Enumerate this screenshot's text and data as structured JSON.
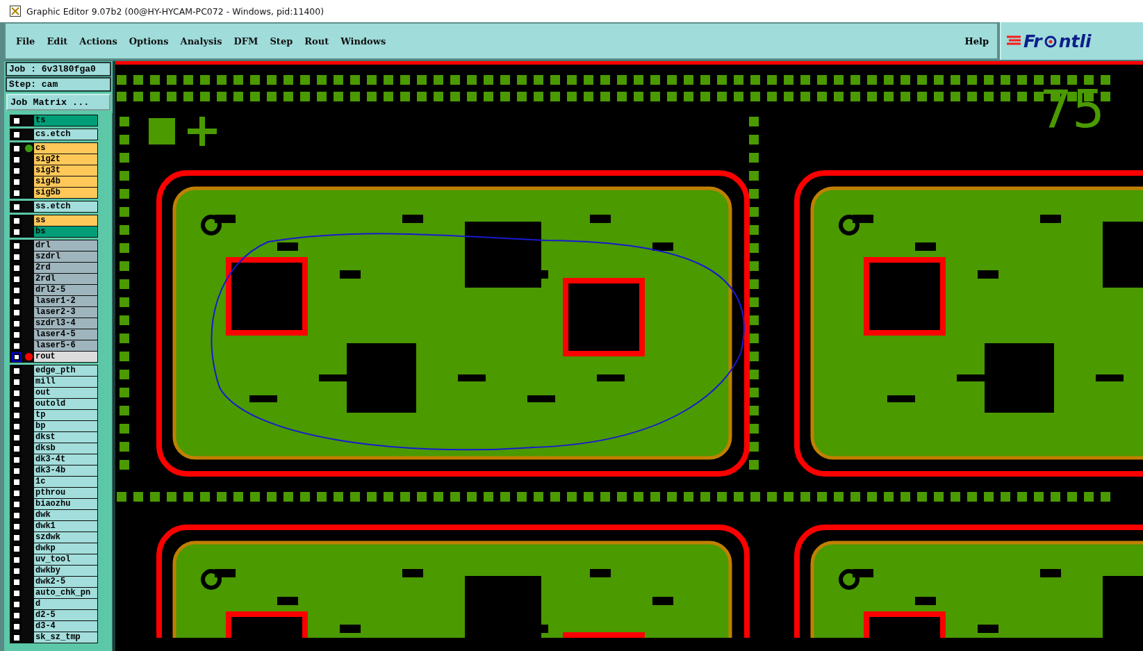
{
  "window": {
    "title": "Graphic Editor 9.07b2 (00@HY-HYCAM-PC072 - Windows, pid:11400)"
  },
  "menu": [
    "File",
    "Edit",
    "Actions",
    "Options",
    "Analysis",
    "DFM",
    "Step",
    "Rout",
    "Windows"
  ],
  "help": "Help",
  "logo": {
    "before": "Fr",
    "after": "ntli"
  },
  "job": "Job : 6v3l80fga0",
  "step": "Step: cam",
  "job_matrix_button": "Job Matrix ...",
  "layer_groups": [
    {
      "layers": [
        {
          "name": "ts",
          "color": "#009e78",
          "selected": false
        }
      ]
    },
    {
      "layers": [
        {
          "name": "cs.etch",
          "color": "#a3dedc",
          "selected": false
        }
      ]
    },
    {
      "layers": [
        {
          "name": "cs",
          "color": "#ffc859",
          "dot": {
            "color": "#3a9a10"
          },
          "selected": false
        },
        {
          "name": "sig2t",
          "color": "#ffc859",
          "selected": false
        },
        {
          "name": "sig3t",
          "color": "#ffc859",
          "selected": false
        },
        {
          "name": "sig4b",
          "color": "#ffc859",
          "selected": false
        },
        {
          "name": "sig5b",
          "color": "#ffc859",
          "selected": false
        }
      ]
    },
    {
      "layers": [
        {
          "name": "ss.etch",
          "color": "#a3dedc",
          "selected": false
        }
      ]
    },
    {
      "layers": [
        {
          "name": "ss",
          "color": "#ffc859",
          "selected": false
        },
        {
          "name": "bs",
          "color": "#009e78",
          "selected": false
        }
      ]
    },
    {
      "layers": [
        {
          "name": "drl",
          "color": "#9fb5bd",
          "selected": false
        },
        {
          "name": "szdrl",
          "color": "#9fb5bd",
          "selected": false
        },
        {
          "name": "2rd",
          "color": "#9fb5bd",
          "selected": false
        },
        {
          "name": "2rdl",
          "color": "#9fb5bd",
          "selected": false
        },
        {
          "name": "drl2-5",
          "color": "#9fb5bd",
          "selected": false
        },
        {
          "name": "laser1-2",
          "color": "#9fb5bd",
          "selected": false
        },
        {
          "name": "laser2-3",
          "color": "#9fb5bd",
          "selected": false
        },
        {
          "name": "szdrl3-4",
          "color": "#9fb5bd",
          "selected": false
        },
        {
          "name": "laser4-5",
          "color": "#9fb5bd",
          "selected": false
        },
        {
          "name": "laser5-6",
          "color": "#9fb5bd",
          "selected": false
        },
        {
          "name": "rout",
          "color": "#dcdcdc",
          "dot": {
            "color": "#ff0000"
          },
          "selected": true
        }
      ]
    },
    {
      "layers": [
        {
          "name": "edge_pth",
          "color": "#a3dedc",
          "selected": false
        },
        {
          "name": "mill",
          "color": "#a3dedc",
          "selected": false
        },
        {
          "name": "out",
          "color": "#a3dedc",
          "selected": false
        },
        {
          "name": "outold",
          "color": "#a3dedc",
          "selected": false
        },
        {
          "name": "tp",
          "color": "#a3dedc",
          "selected": false
        },
        {
          "name": "bp",
          "color": "#a3dedc",
          "selected": false
        },
        {
          "name": "dkst",
          "color": "#a3dedc",
          "selected": false
        },
        {
          "name": "dksb",
          "color": "#a3dedc",
          "selected": false
        },
        {
          "name": "dk3-4t",
          "color": "#a3dedc",
          "selected": false
        },
        {
          "name": "dk3-4b",
          "color": "#a3dedc",
          "selected": false
        },
        {
          "name": "1c",
          "color": "#a3dedc",
          "selected": false
        },
        {
          "name": "pthrou",
          "color": "#a3dedc",
          "selected": false
        },
        {
          "name": "biaozhu",
          "color": "#a3dedc",
          "selected": false
        },
        {
          "name": "dwk",
          "color": "#a3dedc",
          "selected": false
        },
        {
          "name": "dwk1",
          "color": "#a3dedc",
          "selected": false
        },
        {
          "name": "szdwk",
          "color": "#a3dedc",
          "selected": false
        },
        {
          "name": "dwkp",
          "color": "#a3dedc",
          "selected": false
        },
        {
          "name": "uv_tool",
          "color": "#a3dedc",
          "selected": false
        },
        {
          "name": "dwkby",
          "color": "#a3dedc",
          "selected": false
        },
        {
          "name": "dwk2-5",
          "color": "#a3dedc",
          "selected": false
        },
        {
          "name": "auto_chk_pn",
          "color": "#a3dedc",
          "selected": false
        },
        {
          "name": "d",
          "color": "#a3dedc",
          "selected": false
        },
        {
          "name": "d2-5",
          "color": "#a3dedc",
          "selected": false
        },
        {
          "name": "d3-4",
          "color": "#a3dedc",
          "selected": false
        },
        {
          "name": "sk_sz_tmp",
          "color": "#a3dedc",
          "selected": false
        }
      ]
    }
  ],
  "canvas": {
    "label": "75"
  }
}
